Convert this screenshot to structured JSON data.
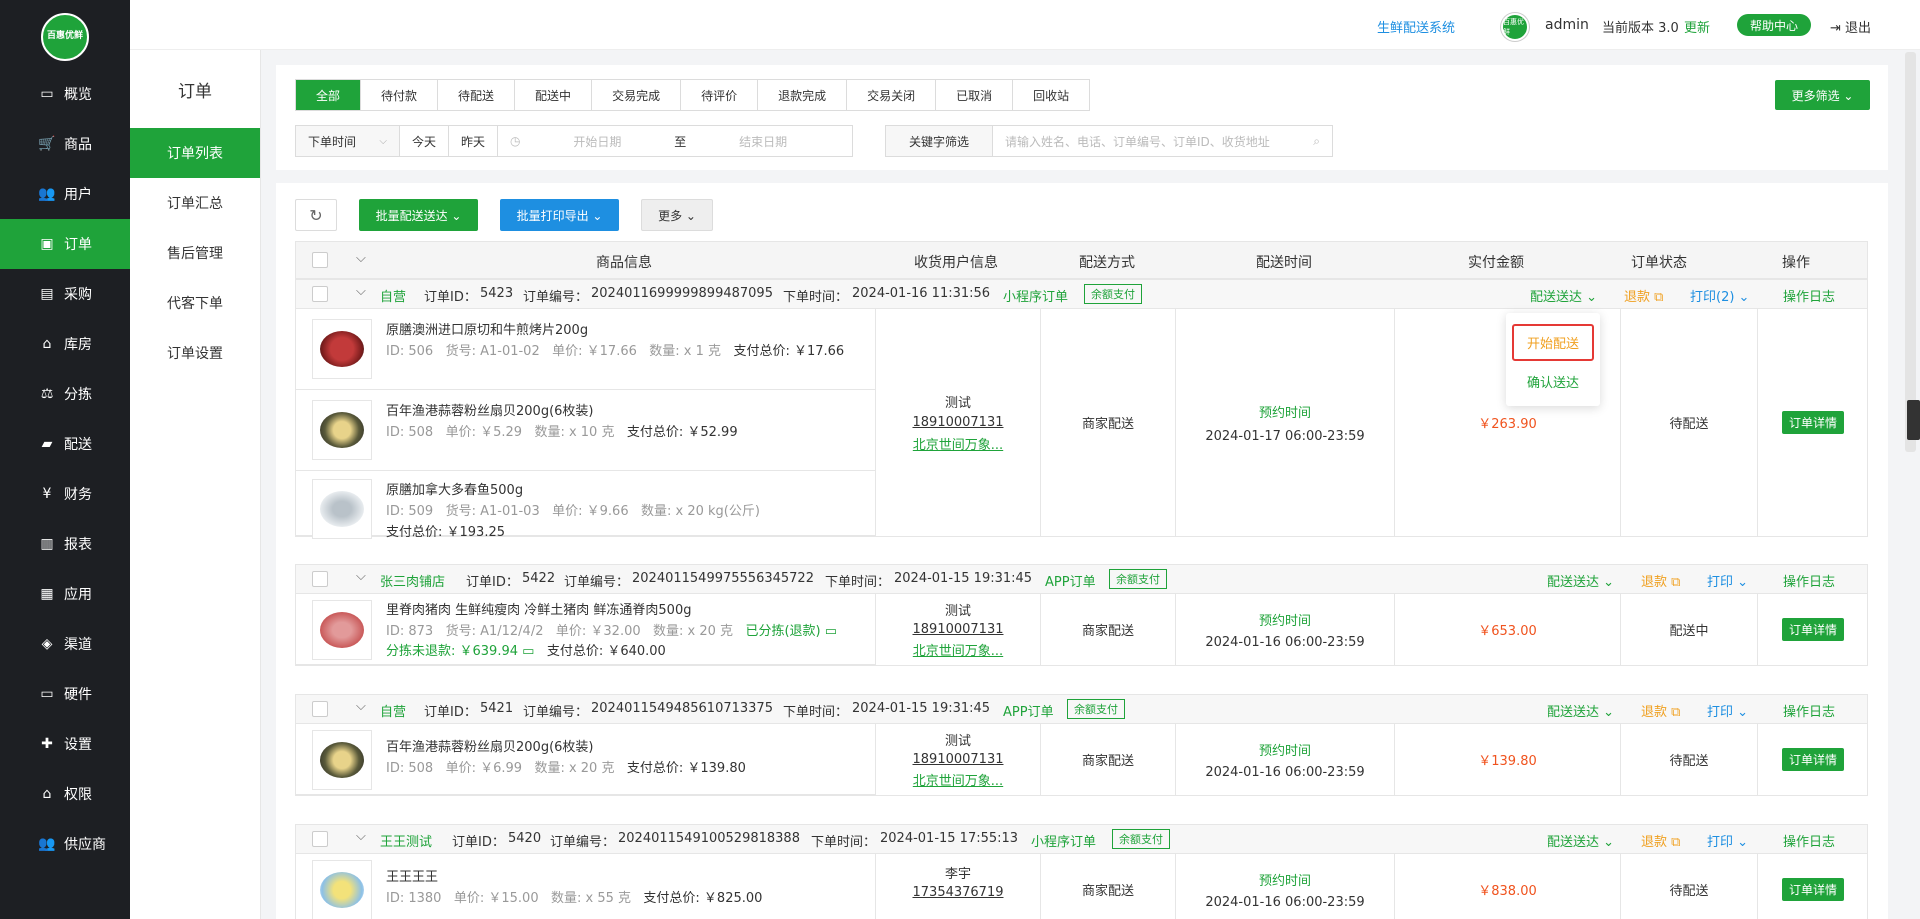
{
  "brand": {
    "logo_text": "百惠优鲜"
  },
  "nav": [
    {
      "icon": "monitor-icon",
      "glyph": "▭",
      "label": "概览"
    },
    {
      "icon": "cart-icon",
      "glyph": "🛒",
      "label": "商品"
    },
    {
      "icon": "users-icon",
      "glyph": "👥",
      "label": "用户"
    },
    {
      "icon": "money-icon",
      "glyph": "▣",
      "label": "订单"
    },
    {
      "icon": "bus-icon",
      "glyph": "▤",
      "label": "采购"
    },
    {
      "icon": "home-icon",
      "glyph": "⌂",
      "label": "库房"
    },
    {
      "icon": "scale-icon",
      "glyph": "⚖",
      "label": "分拣"
    },
    {
      "icon": "truck-icon",
      "glyph": "▰",
      "label": "配送"
    },
    {
      "icon": "yen-icon",
      "glyph": "¥",
      "label": "财务"
    },
    {
      "icon": "chart-icon",
      "glyph": "▥",
      "label": "报表"
    },
    {
      "icon": "grid-icon",
      "glyph": "▦",
      "label": "应用"
    },
    {
      "icon": "cube-icon",
      "glyph": "◈",
      "label": "渠道"
    },
    {
      "icon": "desktop-icon",
      "glyph": "▭",
      "label": "硬件"
    },
    {
      "icon": "puzzle-icon",
      "glyph": "✚",
      "label": "设置"
    },
    {
      "icon": "bank-icon",
      "glyph": "⌂",
      "label": "权限"
    },
    {
      "icon": "supplier-icon",
      "glyph": "👥",
      "label": "供应商"
    }
  ],
  "subnav": {
    "title": "订单",
    "items": [
      "订单列表",
      "订单汇总",
      "售后管理",
      "代客下单",
      "订单设置"
    ]
  },
  "topbar": {
    "system": "生鲜配送系统",
    "avatar_text": "百惠优鲜",
    "user": "admin",
    "version": "当前版本 3.0",
    "update": "更新",
    "help": "帮助中心",
    "logout": "⇥ 退出"
  },
  "filter": {
    "tabs": [
      "全部",
      "待付款",
      "待配送",
      "配送中",
      "交易完成",
      "待评价",
      "退款完成",
      "交易关闭",
      "已取消",
      "回收站"
    ],
    "more_filter": "更多筛选 ⌄",
    "date_type": "下单时间",
    "today": "今天",
    "yesterday": "昨天",
    "start_placeholder": "开始日期",
    "to": "至",
    "end_placeholder": "结束日期",
    "keyword_label": "关键字筛选",
    "keyword_placeholder": "请输入姓名、电话、订单编号、订单ID、收货地址"
  },
  "actions": {
    "batch_deliver": "批量配送送达 ⌄",
    "batch_print": "批量打印导出 ⌄",
    "more": "更多 ⌄"
  },
  "columns": [
    "商品信息",
    "收货用户信息",
    "配送方式",
    "配送时间",
    "实付金额",
    "订单状态",
    "操作"
  ],
  "orders": [
    {
      "shop": "自营",
      "id_label": "订单ID：",
      "id": "5423",
      "no_label": "订单编号：",
      "no": "2024011699999899487095",
      "time_label": "下单时间：",
      "time": "2024-01-16 11:31:56",
      "channel": "小程序订单",
      "pay": "余额支付",
      "op_deliver": "配送送达 ⌄",
      "op_refund": "退款 ⧉",
      "op_print": "打印(2) ⌄",
      "op_log": "操作日志",
      "products": [
        {
          "name": "原膳澳洲进口原切和牛煎烤片200g",
          "id": "ID: 506",
          "sku": "货号: A1-01-02",
          "price": "单价: ￥17.66",
          "qty": "数量: x 1 克",
          "total": "支付总价: ￥17.66"
        },
        {
          "name": "百年渔港蒜蓉粉丝扇贝200g(6枚装)",
          "id": "ID: 508",
          "price": "单价: ￥5.29",
          "qty": "数量: x 10 克",
          "total": "支付总价: ￥52.99"
        },
        {
          "name": "原膳加拿大多春鱼500g",
          "id": "ID: 509",
          "sku": "货号: A1-01-03",
          "price": "单价: ￥9.66",
          "qty": "数量: x 20 kg(公斤)",
          "total": "支付总价: ￥193.25"
        }
      ],
      "receiver": "测试",
      "phone": "18910007131",
      "address": "北京世间万象...",
      "method": "商家配送",
      "appt": "预约时间",
      "slot": "2024-01-17 06:00-23:59",
      "amount": "￥263.90",
      "status": "待配送",
      "detail": "订单详情"
    },
    {
      "shop": "张三肉铺店",
      "id_label": "订单ID：",
      "id": "5422",
      "no_label": "订单编号：",
      "no": "2024011549975556345722",
      "time_label": "下单时间：",
      "time": "2024-01-15 19:31:45",
      "channel": "APP订单",
      "pay": "余额支付",
      "op_deliver": "配送送达 ⌄",
      "op_refund": "退款 ⧉",
      "op_print": "打印 ⌄",
      "op_log": "操作日志",
      "products": [
        {
          "name": "里脊肉猪肉 生鲜纯瘦肉 冷鲜土猪肉 鲜冻通脊肉500g",
          "id": "ID: 873",
          "sku": "货号: A1/12/4/2",
          "price": "单价: ￥32.00",
          "qty": "数量: x 20 克",
          "sorted": "已分拣(退款) ▭",
          "unrefunded": "分拣未退款: ￥639.94 ▭",
          "total": "支付总价: ￥640.00"
        }
      ],
      "receiver": "测试",
      "phone": "18910007131",
      "address": "北京世间万象...",
      "method": "商家配送",
      "appt": "预约时间",
      "slot": "2024-01-16 06:00-23:59",
      "amount": "￥653.00",
      "status": "配送中",
      "detail": "订单详情"
    },
    {
      "shop": "自营",
      "id_label": "订单ID：",
      "id": "5421",
      "no_label": "订单编号：",
      "no": "2024011549485610713375",
      "time_label": "下单时间：",
      "time": "2024-01-15 19:31:45",
      "channel": "APP订单",
      "pay": "余额支付",
      "op_deliver": "配送送达 ⌄",
      "op_refund": "退款 ⧉",
      "op_print": "打印 ⌄",
      "op_log": "操作日志",
      "products": [
        {
          "name": "百年渔港蒜蓉粉丝扇贝200g(6枚装)",
          "id": "ID: 508",
          "price": "单价: ￥6.99",
          "qty": "数量: x 20 克",
          "total": "支付总价: ￥139.80"
        }
      ],
      "receiver": "测试",
      "phone": "18910007131",
      "address": "北京世间万象...",
      "method": "商家配送",
      "appt": "预约时间",
      "slot": "2024-01-16 06:00-23:59",
      "amount": "￥139.80",
      "status": "待配送",
      "detail": "订单详情"
    },
    {
      "shop": "王王测试",
      "id_label": "订单ID：",
      "id": "5420",
      "no_label": "订单编号：",
      "no": "2024011549100529818388",
      "time_label": "下单时间：",
      "time": "2024-01-15 17:55:13",
      "channel": "小程序订单",
      "pay": "余额支付",
      "op_deliver": "配送送达 ⌄",
      "op_refund": "退款 ⧉",
      "op_print": "打印 ⌄",
      "op_log": "操作日志",
      "products": [
        {
          "name": "王王王王",
          "id": "ID: 1380",
          "price": "单价: ￥15.00",
          "qty": "数量: x 55 克",
          "total": "支付总价: ￥825.00"
        }
      ],
      "receiver": "李宇",
      "phone": "17354376719",
      "address": "",
      "method": "商家配送",
      "appt": "预约时间",
      "slot": "2024-01-16 06:00-23:59",
      "amount": "￥838.00",
      "status": "待配送",
      "detail": "订单详情"
    }
  ],
  "dropdown": {
    "start": "开始配送",
    "confirm": "确认送达"
  },
  "colors": {
    "primary": "#1fa33a",
    "blue": "#1e8fe1",
    "orange": "#f0a020",
    "red": "#f0531e",
    "sidebar": "#1d1f23"
  }
}
